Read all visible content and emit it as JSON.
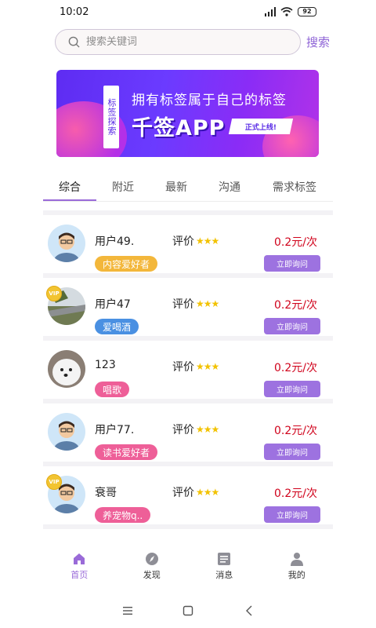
{
  "status_bar": {
    "time": "10:02",
    "battery": "92"
  },
  "search": {
    "placeholder": "搜索关键词",
    "button_label": "搜索"
  },
  "banner": {
    "tag_text": "标签探索",
    "headline": "拥有标签属于自己的标签",
    "app_name": "千签APP",
    "ribbon": "正式上线!"
  },
  "tabs": [
    {
      "label": "综合",
      "active": true
    },
    {
      "label": "附近"
    },
    {
      "label": "最新"
    },
    {
      "label": "沟通"
    },
    {
      "label": "需求标签"
    }
  ],
  "users": [
    {
      "name": "用户49.",
      "rating_label": "评价",
      "stars": "★★★",
      "tag": "内容爱好者",
      "tag_color": "#f3b73b",
      "price": "0.2元/次",
      "button": "立即询问",
      "vip": false
    },
    {
      "name": "用户47",
      "rating_label": "评价",
      "stars": "★★★",
      "tag": "爱喝酒",
      "tag_color": "#4a90e2",
      "price": "0.2元/次",
      "button": "立即询问",
      "vip": true,
      "vip_text": "VIP"
    },
    {
      "name": "123",
      "rating_label": "评价",
      "stars": "★★★",
      "tag": "唱歌",
      "tag_color": "#ee5f98",
      "price": "0.2元/次",
      "button": "立即询问",
      "vip": false
    },
    {
      "name": "用户77.",
      "rating_label": "评价",
      "stars": "★★★",
      "tag": "读书爱好者",
      "tag_color": "#ee5f98",
      "price": "0.2元/次",
      "button": "立即询问",
      "vip": false
    },
    {
      "name": "衰哥",
      "rating_label": "评价",
      "stars": "★★★",
      "tag": "养宠物q..",
      "tag_color": "#ee5f98",
      "price": "0.2元/次",
      "button": "立即询问",
      "vip": true,
      "vip_text": "VIP"
    }
  ],
  "bottom_nav": [
    {
      "label": "首页",
      "icon": "home-icon",
      "active": true
    },
    {
      "label": "发现",
      "icon": "compass-icon"
    },
    {
      "label": "消息",
      "icon": "message-icon"
    },
    {
      "label": "我的",
      "icon": "profile-icon"
    }
  ],
  "colors": {
    "accent": "#9a6bd8",
    "price": "#d0021b",
    "button": "#9d72e0"
  }
}
